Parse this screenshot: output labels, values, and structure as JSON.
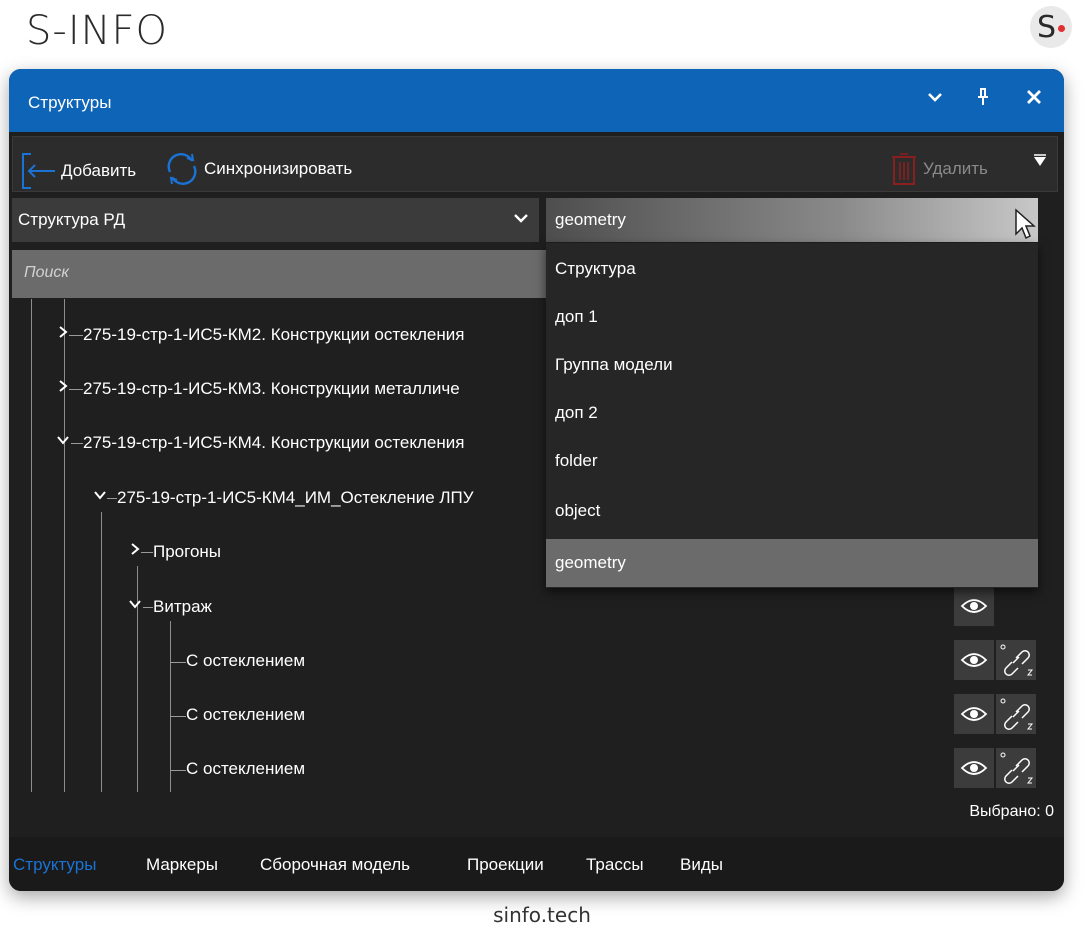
{
  "app": {
    "brand": "S-INFO",
    "logo_letter": "S",
    "footer": "sinfo.tech"
  },
  "window": {
    "title": "Структуры",
    "icons": [
      "chevron-down-icon",
      "pin-icon",
      "close-icon"
    ]
  },
  "toolbar": {
    "add_label": "Добавить",
    "sync_label": "Синхронизировать",
    "delete_label": "Удалить"
  },
  "structure_select": {
    "value": "Структура РД"
  },
  "attr_select": {
    "value": "geometry",
    "options": [
      "Структура",
      "доп 1",
      "Группа модели",
      "доп 2",
      "folder",
      "object",
      "geometry"
    ],
    "selected_index": 6
  },
  "search": {
    "placeholder": "Поиск"
  },
  "tree": {
    "nodes": [
      {
        "label": "275-19-стр-1-ИС5-КМ2. Конструкции остекления",
        "expanded": false
      },
      {
        "label": "275-19-стр-1-ИС5-КМ3. Конструкции металличе",
        "expanded": false
      },
      {
        "label": "275-19-стр-1-ИС5-КМ4. Конструкции остекления",
        "expanded": true
      },
      {
        "label": "275-19-стр-1-ИС5-КМ4_ИМ_Остекление ЛПУ",
        "expanded": true
      },
      {
        "label": "Прогоны",
        "expanded": false
      },
      {
        "label": "Витраж",
        "expanded": true
      },
      {
        "label": "С остеклением"
      },
      {
        "label": "С остеклением"
      },
      {
        "label": "С остеклением"
      }
    ]
  },
  "status": {
    "selected": "Выбрано: 0"
  },
  "tabs": [
    {
      "label": "Структуры",
      "active": true
    },
    {
      "label": "Маркеры"
    },
    {
      "label": "Сборочная модель"
    },
    {
      "label": "Проекции"
    },
    {
      "label": "Трассы"
    },
    {
      "label": "Виды"
    }
  ],
  "colors": {
    "accent": "#0e64b6",
    "active_tab": "#1a73d4",
    "panel": "#1f1f1f",
    "delete_icon": "#8a1f1f"
  }
}
